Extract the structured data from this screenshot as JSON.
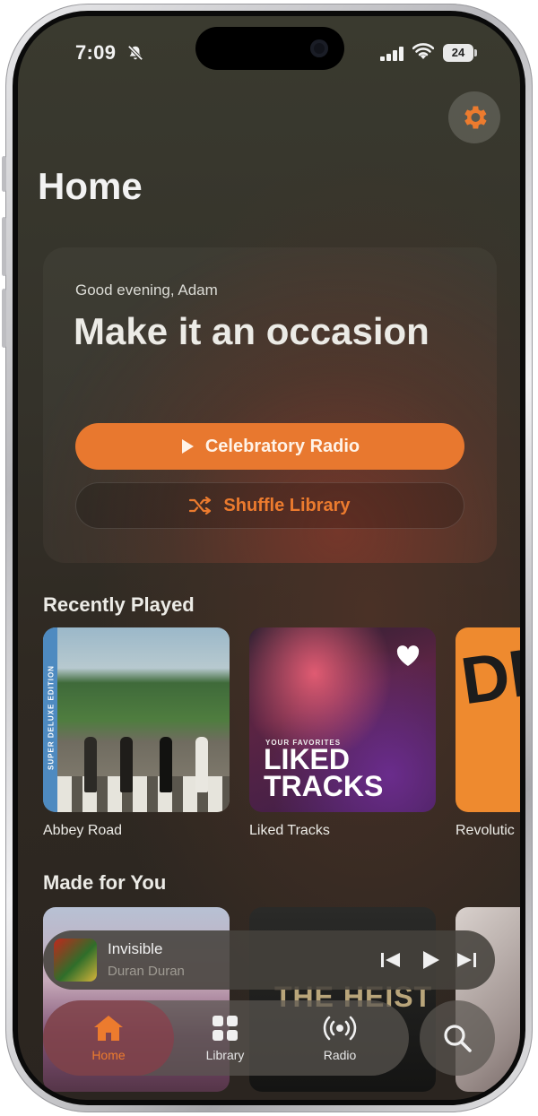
{
  "status_bar": {
    "time": "7:09",
    "battery": "24"
  },
  "header": {
    "title": "Home"
  },
  "hero": {
    "greeting": "Good evening, Adam",
    "headline": "Make it an occasion",
    "primary_button": "Celebratory Radio",
    "secondary_button": "Shuffle Library"
  },
  "recently_played": {
    "title": "Recently Played",
    "items": [
      {
        "label": "Abbey Road",
        "art_text": "SUPER DELUXE EDITION"
      },
      {
        "label": "Liked Tracks",
        "art_small": "YOUR FAVORITES",
        "art_big": "LIKED TRACKS"
      },
      {
        "label": "Revolutic",
        "art_text": "DIPLO"
      }
    ]
  },
  "made_for_you": {
    "title": "Made for You",
    "items": [
      {
        "art_text": ""
      },
      {
        "art_text": "THE HEIST"
      },
      {
        "art_text": ""
      }
    ]
  },
  "mini_player": {
    "title": "Invisible",
    "artist": "Duran Duran"
  },
  "tab_bar": {
    "tabs": [
      {
        "label": "Home",
        "icon": "house-icon"
      },
      {
        "label": "Library",
        "icon": "grid-icon"
      },
      {
        "label": "Radio",
        "icon": "broadcast-icon"
      }
    ]
  },
  "colors": {
    "accent": "#e8782f",
    "accent_text": "#ec7b2e"
  }
}
